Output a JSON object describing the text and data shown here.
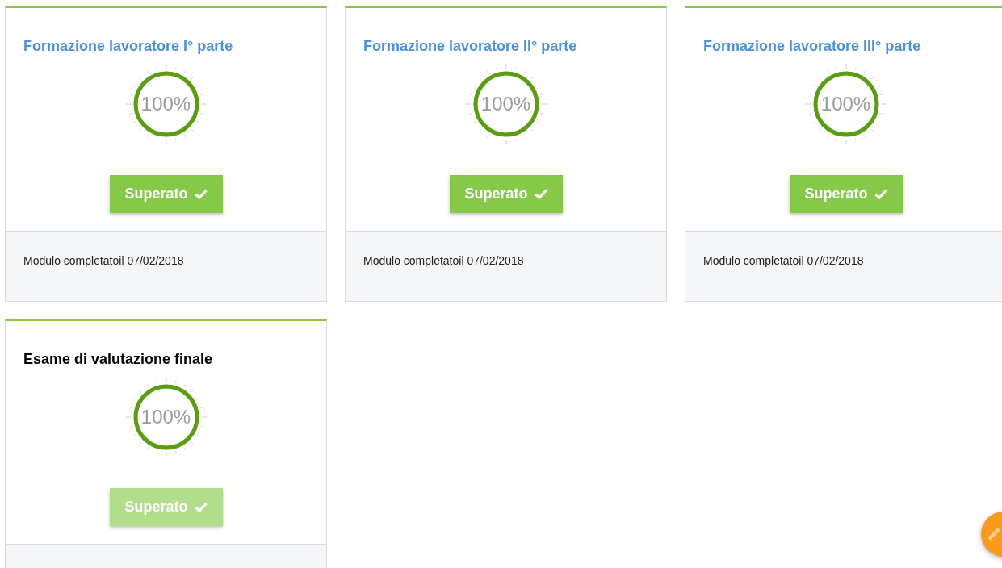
{
  "cards": [
    {
      "title": "Formazione lavoratore I° parte",
      "title_link": true,
      "progress": {
        "level": 1,
        "reading": "100%"
      },
      "button": {
        "label": "Superato",
        "disabled": false
      },
      "footer": "Modulo completatoil 07/02/2018"
    },
    {
      "title": "Formazione lavoratore II° parte",
      "title_link": true,
      "progress": {
        "level": 1,
        "reading": "100%"
      },
      "button": {
        "label": "Superato",
        "disabled": false
      },
      "footer": "Modulo completatoil 07/02/2018"
    },
    {
      "title": "Formazione lavoratore III° parte",
      "title_link": true,
      "progress": {
        "level": 1,
        "reading": "100%"
      },
      "button": {
        "label": "Superato",
        "disabled": false
      },
      "footer": "Modulo completatoil 07/02/2018"
    },
    {
      "title": "Esame di valutazione finale",
      "title_link": false,
      "progress": {
        "level": 1,
        "reading": "100%"
      },
      "button": {
        "label": "Superato",
        "disabled": true
      }
    }
  ]
}
